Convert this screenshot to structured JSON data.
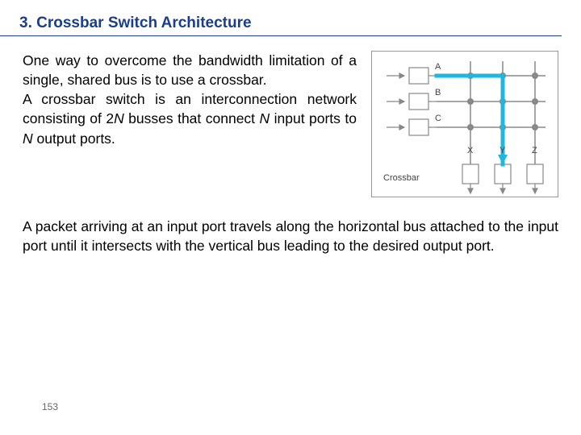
{
  "heading": "3. Crossbar Switch Architecture",
  "para1_a": "One way to overcome the bandwidth limitation of a single, shared bus is to use a crossbar.",
  "para1_b_pre": "A crossbar switch is an interconnection network consisting of 2",
  "para1_b_N1": "N",
  "para1_b_mid": " busses that connect ",
  "para1_b_N2": "N",
  "para1_b_mid2": " input ports to ",
  "para1_b_N3": "N",
  "para1_b_post": " output ports.",
  "para2": "A packet arriving at an input port travels along the horizontal bus attached to the input port until it intersects with the vertical bus leading to the desired output port.",
  "page_number": "153",
  "diagram": {
    "input_labels": [
      "A",
      "B",
      "C"
    ],
    "output_labels": [
      "X",
      "Y",
      "Z"
    ],
    "caption": "Crossbar"
  }
}
